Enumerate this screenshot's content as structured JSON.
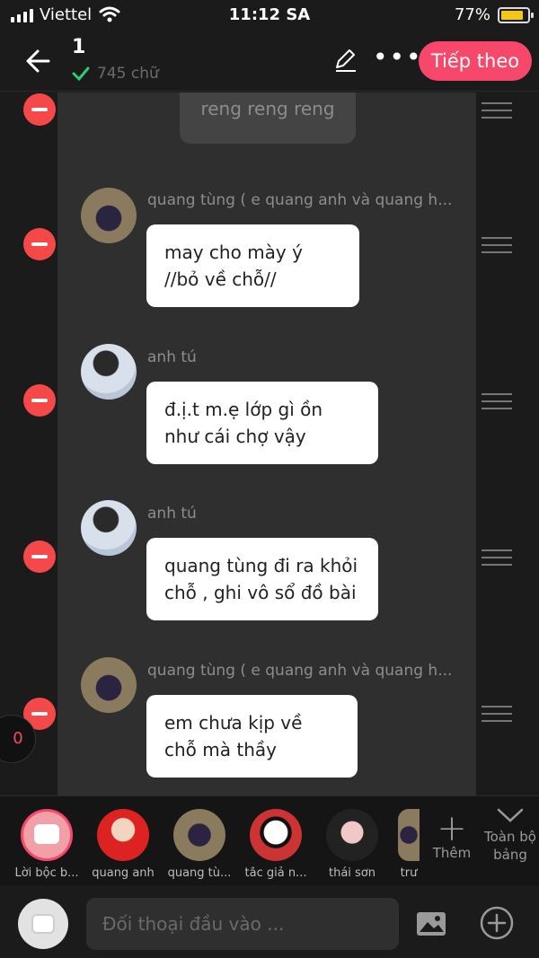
{
  "status_bar": {
    "carrier": "Viettel",
    "time": "11:12 SA",
    "battery": "77%",
    "battery_level": 0.77
  },
  "nav": {
    "chapter": "1",
    "word_count": "745 chữ",
    "next_label": "Tiếp theo"
  },
  "narration_text": "reng reng reng",
  "messages": [
    {
      "sender": "quang tùng ( e quang anh và quang h...",
      "text": "may cho mày ý //bỏ về chỗ//"
    },
    {
      "sender": "anh tú",
      "text": "đ.ị.t m.ẹ lớp gì ồn như cái chợ vậy"
    },
    {
      "sender": "anh tú",
      "text": "quang tùng đi ra khỏi chỗ , ghi vô sổ đồ bài"
    },
    {
      "sender": "quang tùng ( e quang anh và quang h...",
      "text": "em chưa kịp về chỗ mà thầy"
    }
  ],
  "side_counter": "0",
  "characters": [
    {
      "name": "Lời bộc b..."
    },
    {
      "name": "quang anh"
    },
    {
      "name": "quang tù..."
    },
    {
      "name": "tắc giả n..."
    },
    {
      "name": "thái sơn"
    },
    {
      "name": "trư"
    }
  ],
  "more_label": "Thêm",
  "all_board_label": "Toàn bộ bảng",
  "input": {
    "placeholder": "Đối thoại đầu vào ..."
  },
  "colors": {
    "accent": "#f7486b",
    "delete": "#f54848",
    "panel": "#2f2f2f",
    "bg": "#1b1b1b"
  }
}
